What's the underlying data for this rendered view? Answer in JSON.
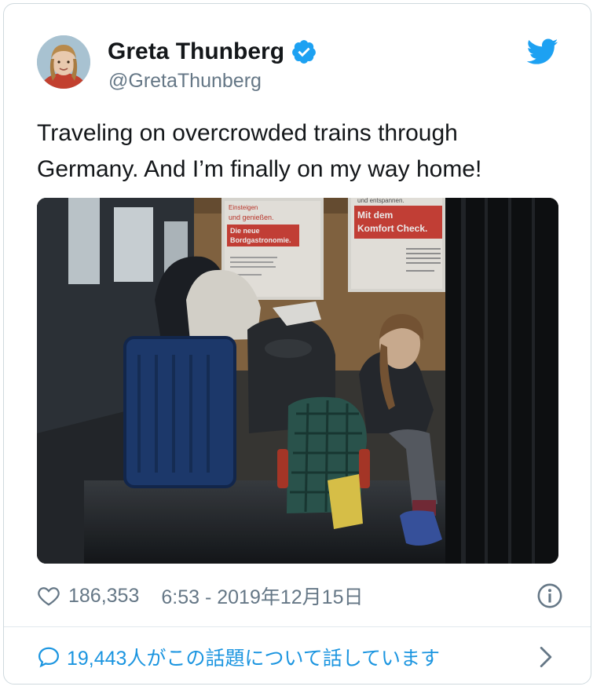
{
  "user": {
    "name": "Greta Thunberg",
    "handle": "@GretaThunberg"
  },
  "tweet": {
    "text_line1": "Traveling on overcrowded trains through",
    "text_line2": "Germany. And I’m finally on my way home!"
  },
  "media": {
    "sign_left_line1": "Einsteigen",
    "sign_left_line2": "und genießen.",
    "sign_left_line3": "Die neue",
    "sign_left_line4": "Bordgastronomie.",
    "sign_right_top": "und entspannen.",
    "sign_right_line1": "Mit dem",
    "sign_right_line2": "Komfort Check."
  },
  "footer": {
    "likes": "186,353",
    "timestamp": "6:53 - 2019年12月15日",
    "conversation": "19,443人がこの話題について話しています"
  },
  "colors": {
    "verified": "#1da1f2",
    "twitter_bird": "#1da1f2",
    "link": "#1b95e0",
    "muted": "#657786"
  },
  "icons": [
    "verified-badge-icon",
    "twitter-bird-icon",
    "heart-icon",
    "info-icon",
    "comment-bubble-icon",
    "chevron-right-icon"
  ]
}
